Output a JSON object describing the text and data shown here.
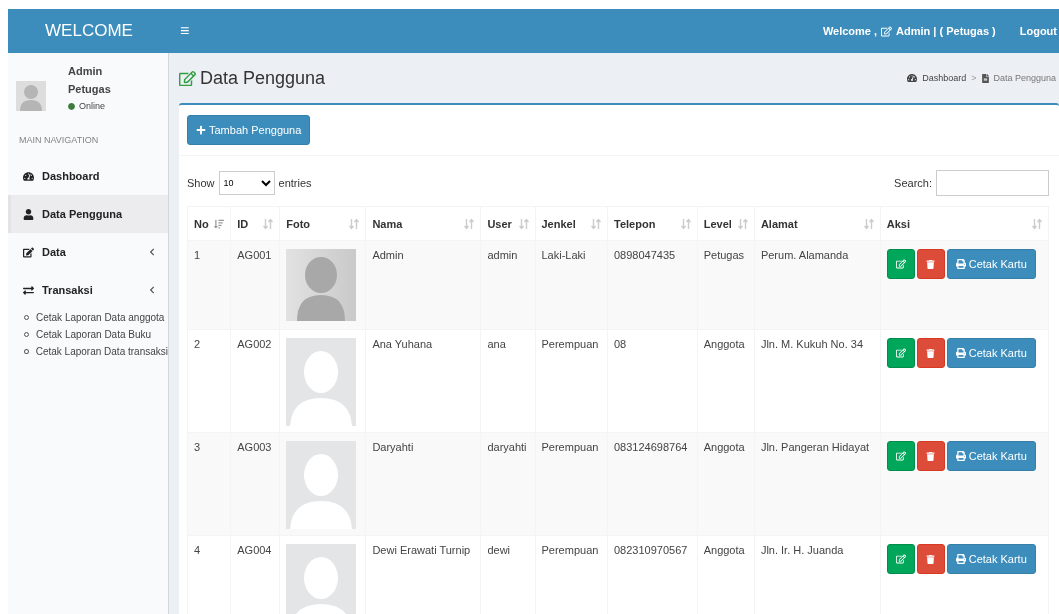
{
  "header": {
    "brand": "WELCOME",
    "menu_toggle": "≡",
    "welcome": "Welcome ,",
    "user": "Admin | ( Petugas )",
    "logout": "Logout"
  },
  "sidebar": {
    "user": {
      "name": "Admin",
      "role": "Petugas",
      "status": "Online"
    },
    "section": "MAIN NAVIGATION",
    "items": [
      {
        "label": "Dashboard",
        "selected": false,
        "has_caret": false
      },
      {
        "label": "Data Pengguna",
        "selected": true,
        "has_caret": false
      },
      {
        "label": "Data",
        "selected": false,
        "has_caret": true
      },
      {
        "label": "Transaksi",
        "selected": false,
        "has_caret": true,
        "children": [
          {
            "label": "Cetak Laporan Data anggota"
          },
          {
            "label": "Cetak Laporan Data Buku"
          },
          {
            "label": "Cetak Laporan Data transaksi"
          }
        ]
      }
    ]
  },
  "page": {
    "title": "Data Pengguna",
    "breadcrumb": [
      "Dashboard",
      "Data Pengguna"
    ],
    "breadcrumb_separator": ">"
  },
  "toolbar": {
    "add_button": "Tambah Pengguna",
    "show_label": "Show",
    "page_size": "10",
    "entries_label": "entries",
    "search_label": "Search:"
  },
  "table": {
    "columns": [
      {
        "label": "No",
        "sorted": true
      },
      {
        "label": "ID",
        "sorted": false
      },
      {
        "label": "Foto",
        "sorted": false
      },
      {
        "label": "Nama",
        "sorted": false
      },
      {
        "label": "User",
        "sorted": false
      },
      {
        "label": "Jenkel",
        "sorted": false
      },
      {
        "label": "Telepon",
        "sorted": false
      },
      {
        "label": "Level",
        "sorted": false
      },
      {
        "label": "Alamat",
        "sorted": false
      },
      {
        "label": "Aksi",
        "sorted": false
      }
    ],
    "rows": [
      {
        "no": "1",
        "id": "AG001",
        "kind": "photo",
        "nama": "Admin",
        "user": "admin",
        "jenkel": "Laki-Laki",
        "telepon": "0898047435",
        "level": "Petugas",
        "alamat": "Perum. Alamanda",
        "print": "Cetak Kartu"
      },
      {
        "no": "2",
        "id": "AG002",
        "kind": "placeholder",
        "nama": "Ana Yuhana",
        "user": "ana",
        "jenkel": "Perempuan",
        "telepon": "08",
        "level": "Anggota",
        "alamat": "Jln. M. Kukuh No. 34",
        "print": "Cetak Kartu"
      },
      {
        "no": "3",
        "id": "AG003",
        "kind": "placeholder",
        "nama": "Daryahti",
        "user": "daryahti",
        "jenkel": "Perempuan",
        "telepon": "083124698764",
        "level": "Anggota",
        "alamat": "Jln. Pangeran Hidayat",
        "print": "Cetak Kartu"
      },
      {
        "no": "4",
        "id": "AG004",
        "kind": "placeholder",
        "nama": "Dewi Erawati Turnip",
        "user": "dewi",
        "jenkel": "Perempuan",
        "telepon": "082310970567",
        "level": "Anggota",
        "alamat": "Jln. Ir. H. Juanda",
        "print": "Cetak Kartu"
      }
    ]
  }
}
